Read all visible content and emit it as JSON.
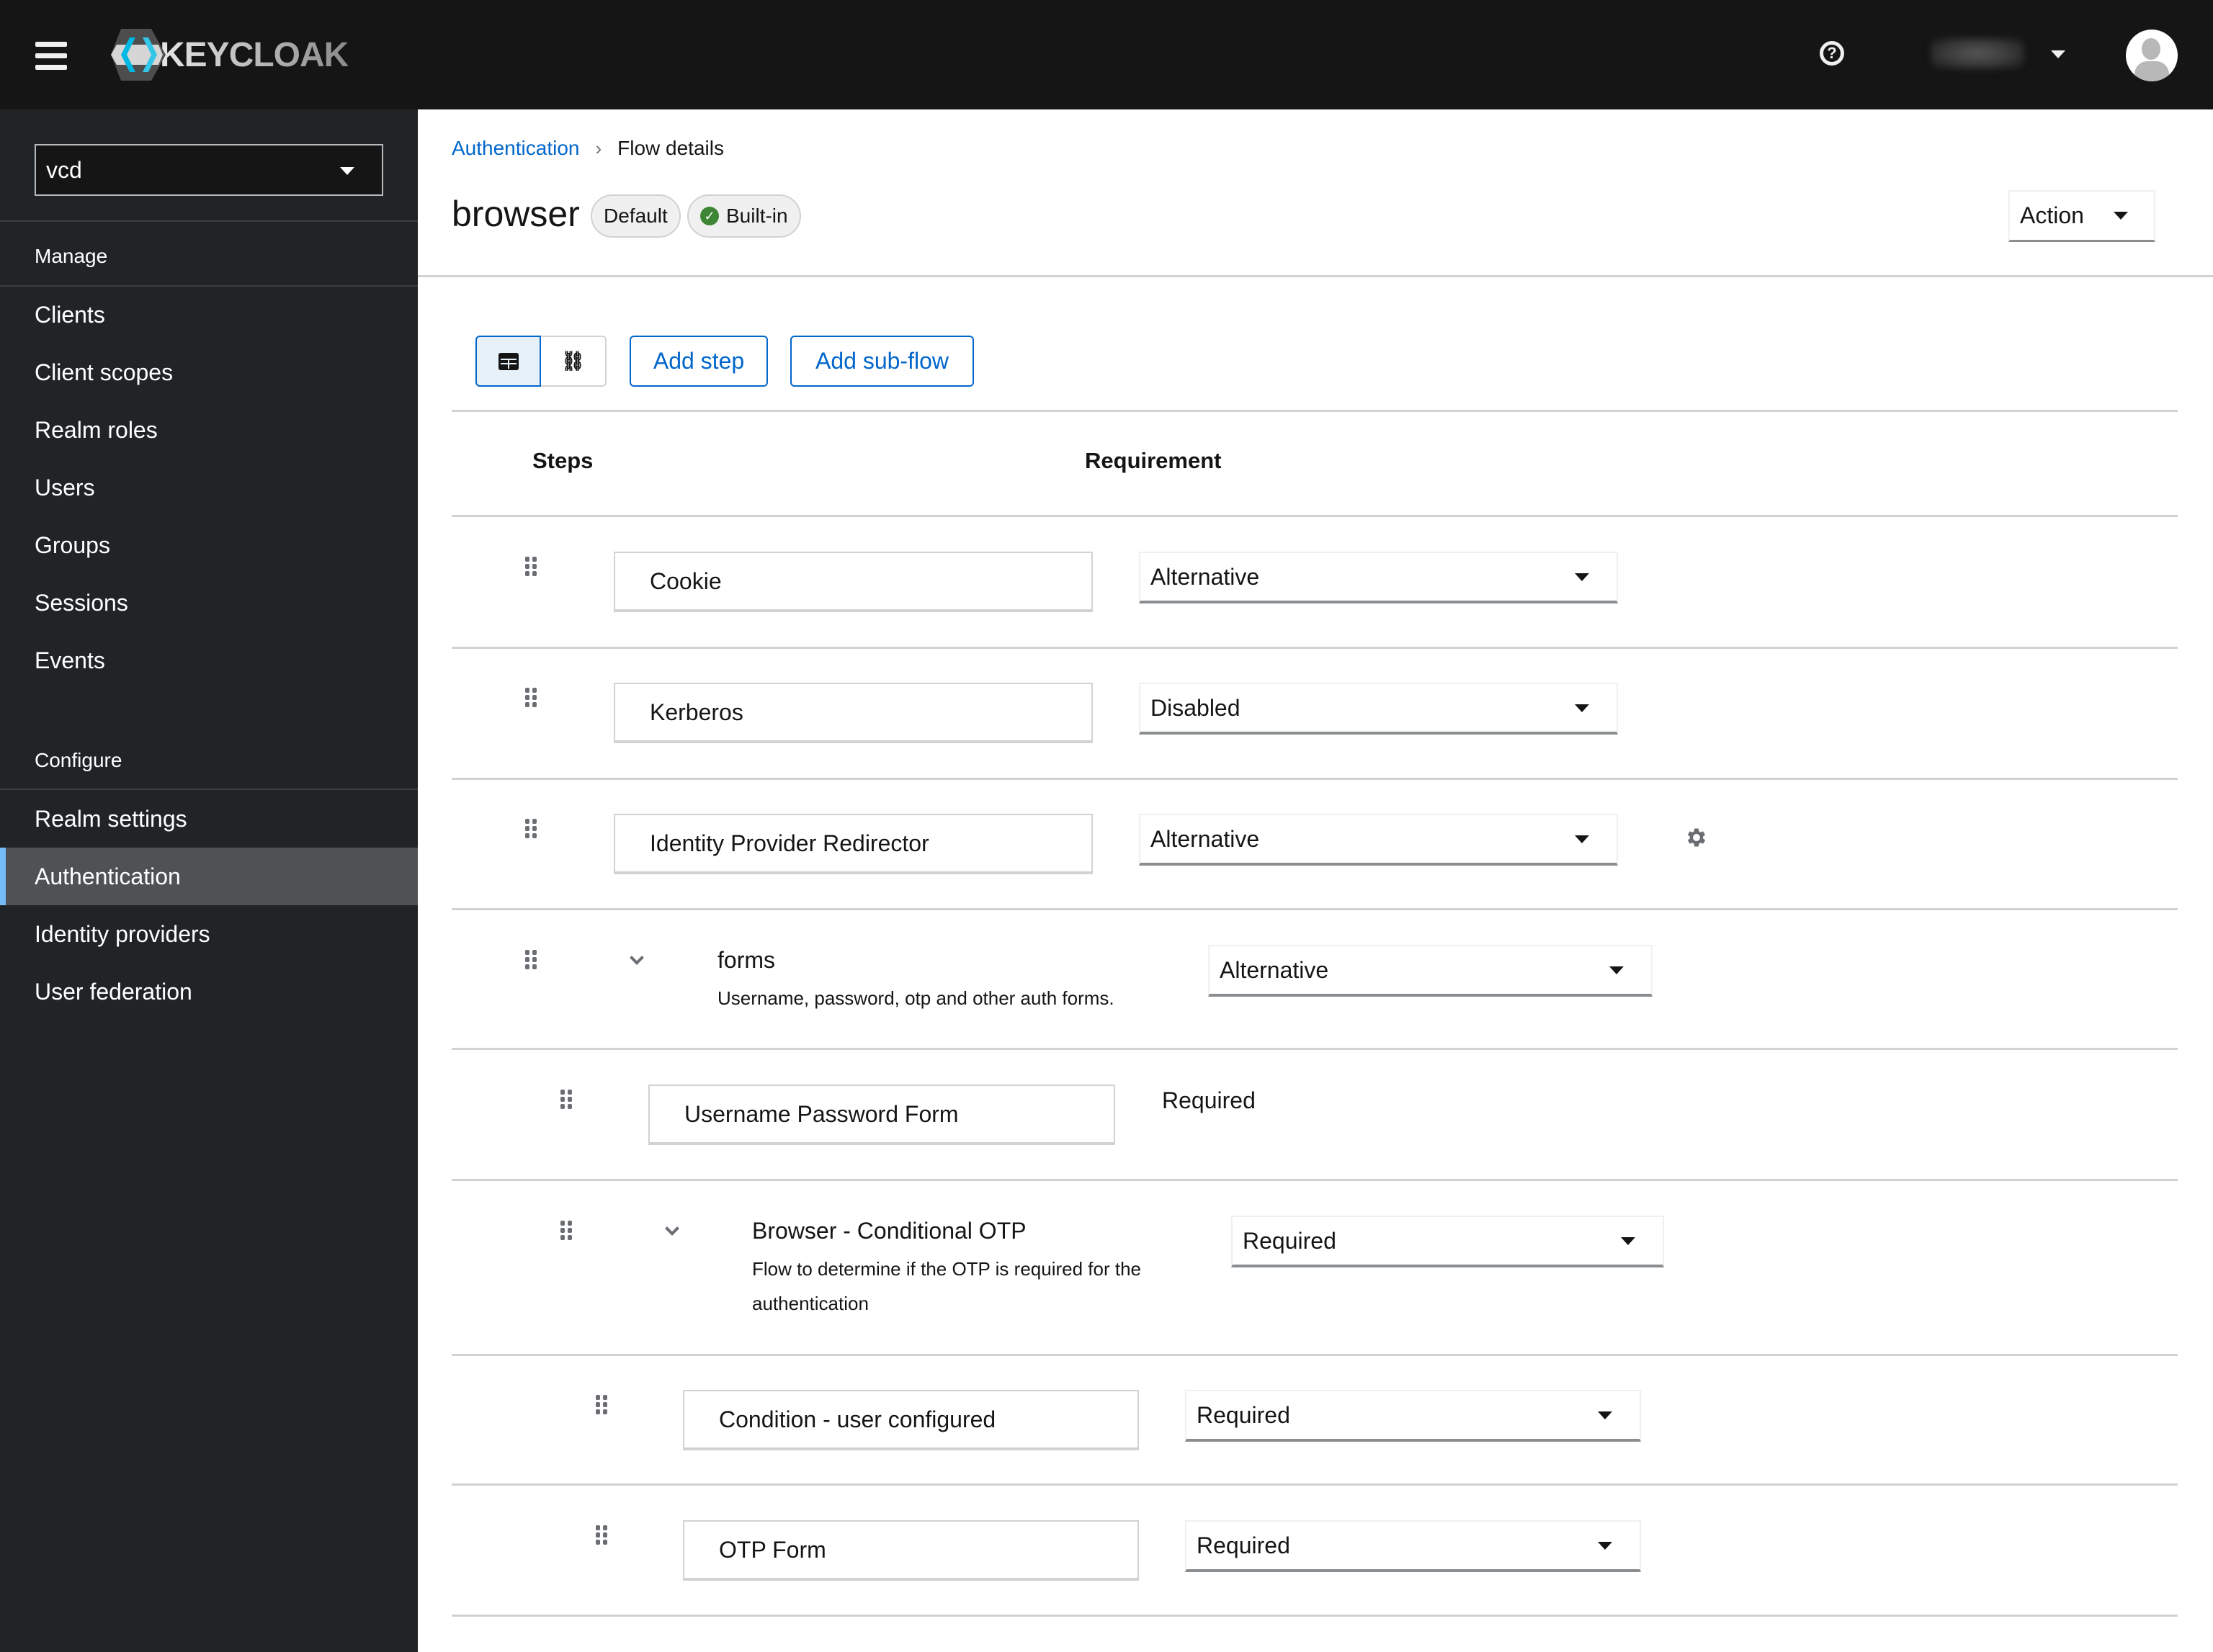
{
  "masthead": {
    "brand": "KEYCLOAK",
    "icons": {
      "menu": "hamburger-icon",
      "help": "help-circle-icon",
      "user_menu": "caret-down-icon",
      "avatar": "user-avatar-icon"
    },
    "help_glyph": "?"
  },
  "sidebar": {
    "realm": "vcd",
    "sections": [
      {
        "title": "Manage",
        "items": [
          "Clients",
          "Client scopes",
          "Realm roles",
          "Users",
          "Groups",
          "Sessions",
          "Events"
        ]
      },
      {
        "title": "Configure",
        "items": [
          "Realm settings",
          "Authentication",
          "Identity providers",
          "User federation"
        ]
      }
    ],
    "active_item": "Authentication",
    "active_color": "#73bcf7"
  },
  "breadcrumb": {
    "items": [
      "Authentication",
      "Flow details"
    ],
    "separator": "›"
  },
  "header": {
    "title": "browser",
    "labels": [
      {
        "text": "Default"
      },
      {
        "text": "Built-in",
        "icon": "check-circle-icon",
        "icon_glyph": "✓",
        "icon_color": "#3e8635"
      }
    ],
    "action_label": "Action"
  },
  "toolbar": {
    "view_toggle": [
      {
        "name": "table-view",
        "active": true
      },
      {
        "name": "diagram-view",
        "active": false
      }
    ],
    "diagram_glyph": "⛓",
    "add_step": "Add step",
    "add_subflow": "Add sub-flow"
  },
  "table": {
    "columns": [
      "Steps",
      "Requirement"
    ],
    "rows": [
      {
        "level": 0,
        "type": "step",
        "name": "Cookie",
        "requirement": "Alternative",
        "editable": true
      },
      {
        "level": 0,
        "type": "step",
        "name": "Kerberos",
        "requirement": "Disabled",
        "editable": true
      },
      {
        "level": 0,
        "type": "step",
        "name": "Identity Provider Redirector",
        "requirement": "Alternative",
        "editable": true,
        "config": true
      },
      {
        "level": 0,
        "type": "flow",
        "name": "forms",
        "description": "Username, password, otp and other auth forms.",
        "requirement": "Alternative",
        "editable": true,
        "expanded": true
      },
      {
        "level": 1,
        "type": "step",
        "name": "Username Password Form",
        "requirement": "Required",
        "editable": false
      },
      {
        "level": 1,
        "type": "flow",
        "name": "Browser - Conditional OTP",
        "description_lines": [
          "Flow to determine if the OTP is required for the",
          "authentication"
        ],
        "requirement": "Required",
        "editable": true,
        "expanded": true
      },
      {
        "level": 2,
        "type": "step",
        "name": "Condition - user configured",
        "requirement": "Required",
        "editable": true
      },
      {
        "level": 2,
        "type": "step",
        "name": "OTP Form",
        "requirement": "Required",
        "editable": true
      }
    ]
  }
}
